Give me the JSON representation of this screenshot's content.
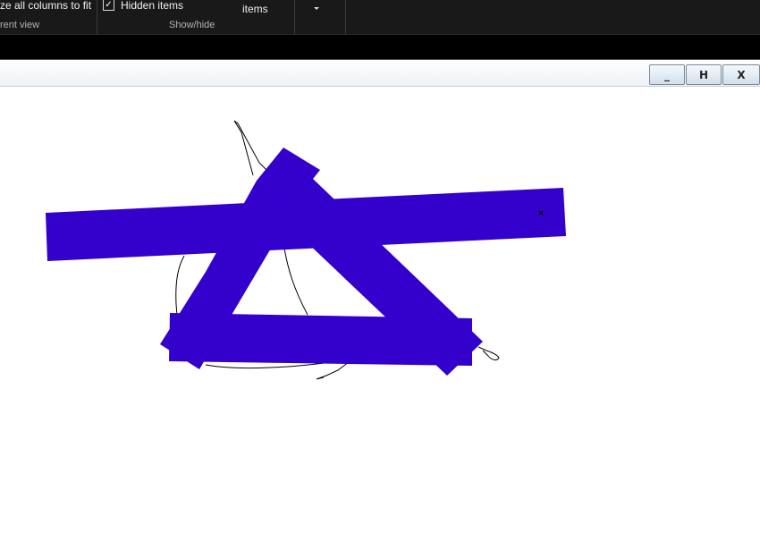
{
  "ribbon": {
    "resize_columns_label": "ze all columns to fit",
    "current_view_label": "rent view",
    "hidden_items_label": "Hidden items",
    "hidden_items_checked": true,
    "hide_selected_label": "items",
    "show_hide_label": "Show/hide",
    "options_caret_icon": "chevron-down-icon"
  },
  "window_controls": {
    "minimize_label": "_",
    "maximize_label": "H",
    "close_label": "X"
  },
  "drawing": {
    "brush_color": "#3300cc",
    "pen_color": "#000000",
    "background_color": "#ffffff"
  }
}
